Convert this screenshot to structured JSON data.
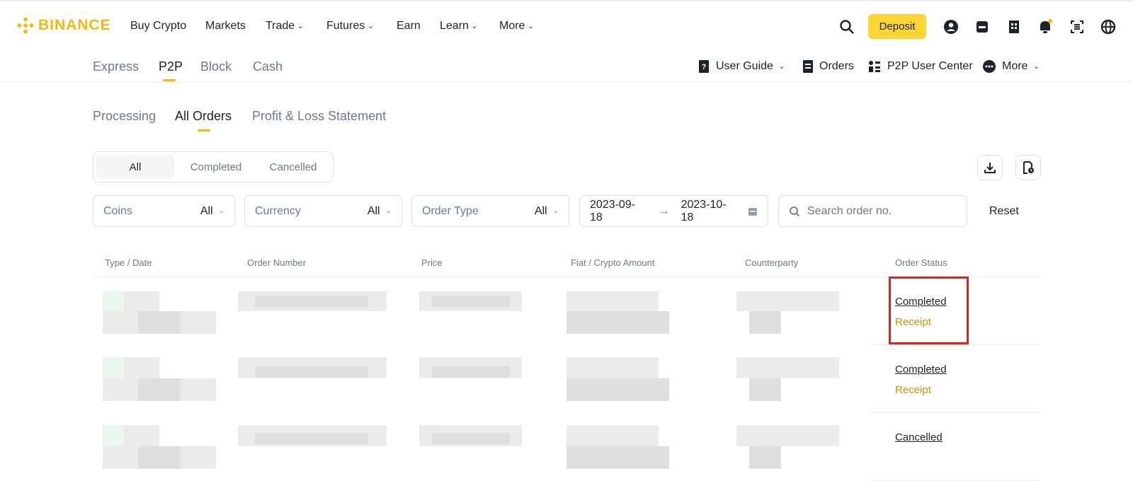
{
  "header": {
    "logo_text": "BINANCE",
    "nav": [
      "Buy Crypto",
      "Markets",
      "Trade",
      "Futures",
      "Earn",
      "Learn",
      "More"
    ],
    "nav_has_dropdown": [
      false,
      false,
      true,
      true,
      false,
      true,
      true
    ],
    "deposit_label": "Deposit",
    "brand_color": "#F0B90B",
    "right_icons": [
      "search-icon",
      "user-icon",
      "wallet-icon",
      "orders-icon",
      "bell-icon",
      "download-app-icon",
      "globe-icon"
    ]
  },
  "subnav": {
    "tabs": [
      "Express",
      "P2P",
      "Block",
      "Cash"
    ],
    "active_tab": "P2P",
    "right": [
      {
        "label": "User Guide",
        "icon": "guide-icon",
        "dropdown": true
      },
      {
        "label": "Orders",
        "icon": "document-icon",
        "dropdown": false
      },
      {
        "label": "P2P User Center",
        "icon": "user-center-icon",
        "dropdown": false
      },
      {
        "label": "More",
        "icon": "more-dots-icon",
        "dropdown": true
      }
    ]
  },
  "order_tabs": {
    "items": [
      "Processing",
      "All Orders",
      "Profit & Loss Statement"
    ],
    "active": "All Orders"
  },
  "status_filter": {
    "items": [
      "All",
      "Completed",
      "Cancelled"
    ],
    "active": "All"
  },
  "filters": {
    "coins": {
      "label": "Coins",
      "value": "All"
    },
    "currency": {
      "label": "Currency",
      "value": "All"
    },
    "order_type": {
      "label": "Order Type",
      "value": "All"
    },
    "date_from": "2023-09-18",
    "date_to": "2023-10-18",
    "search_placeholder": "Search order no.",
    "reset_label": "Reset"
  },
  "table": {
    "columns": [
      "Type / Date",
      "Order Number",
      "Price",
      "Fiat / Crypto Amount",
      "Counterparty",
      "Order Status"
    ],
    "rows": [
      {
        "status": "Completed",
        "receipt": "Receipt"
      },
      {
        "status": "Completed",
        "receipt": "Receipt"
      },
      {
        "status": "Cancelled",
        "receipt": ""
      }
    ]
  },
  "colors": {
    "accent": "#F0B90B",
    "deposit_bg": "#FCD535",
    "receipt": "#C99400",
    "highlight": "#e8201b"
  }
}
